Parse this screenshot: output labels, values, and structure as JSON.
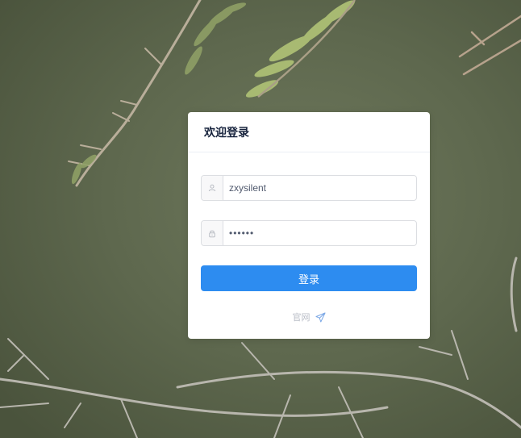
{
  "login": {
    "title": "欢迎登录",
    "username": {
      "value": "zxysilent",
      "icon": "user-icon"
    },
    "password": {
      "value": "••••••",
      "icon": "lock-icon"
    },
    "submit_label": "登录",
    "footer_link_label": "官网",
    "footer_icon": "paper-plane-icon"
  },
  "colors": {
    "primary": "#2d8cf0",
    "title": "#17233d",
    "border": "#dcdee2",
    "muted": "#b8bcc6"
  }
}
